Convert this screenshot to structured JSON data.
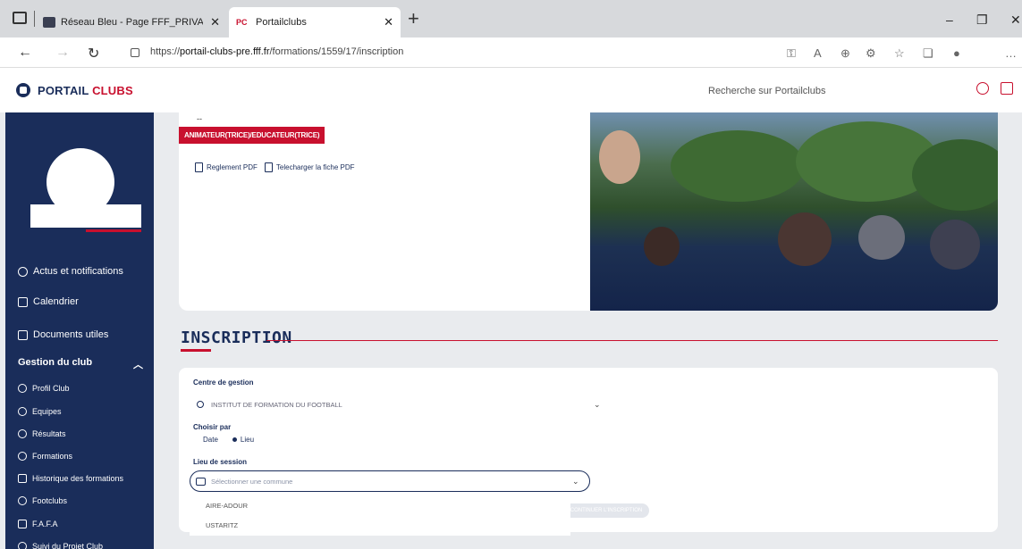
{
  "browser": {
    "tabs": [
      {
        "title": "Réseau Bleu - Page FFF_PRIVATE",
        "favicon": "database-icon"
      },
      {
        "title": "Portailclubs",
        "favicon_text": "PC"
      }
    ],
    "url_prefix": "https://",
    "url_host": "portail-clubs-pre.fff.fr",
    "url_path": "/formations/1559/17/inscription"
  },
  "header": {
    "logo_part1": "PORTAIL",
    "logo_part2": "CLUBS",
    "search_placeholder": "Recherche sur Portailclubs"
  },
  "sidebar": {
    "items": [
      {
        "label": "Actus et notifications",
        "icon": "bell-icon"
      },
      {
        "label": "Calendrier",
        "icon": "calendar-icon"
      },
      {
        "label": "Documents utiles",
        "icon": "document-icon"
      }
    ],
    "section_label": "Gestion du club",
    "sub_items": [
      {
        "label": "Profil Club",
        "icon": "shield-icon"
      },
      {
        "label": "Equipes",
        "icon": "team-icon"
      },
      {
        "label": "Résultats",
        "icon": "trophy-icon"
      },
      {
        "label": "Formations",
        "icon": "graduation-icon"
      },
      {
        "label": "Historique des formations",
        "icon": "history-icon"
      },
      {
        "label": "Footclubs",
        "icon": "gear-icon"
      },
      {
        "label": "F.A.F.A",
        "icon": "wallet-icon"
      },
      {
        "label": "Suivi du Projet Club",
        "icon": "target-icon"
      }
    ]
  },
  "formation": {
    "dash": "--",
    "role_badge": "ANIMATEUR(TRICE)/EDUCATEUR(TRICE)",
    "pdf_links": [
      "Reglement PDF",
      "Telecharger la fiche PDF"
    ]
  },
  "inscription": {
    "title": "INSCRIPTION",
    "centre_label": "Centre de gestion",
    "centre_value": "INSTITUT DE FORMATION DU FOOTBALL",
    "choice_label": "Choisir par",
    "choice_options": [
      "Date",
      "Lieu"
    ],
    "choice_selected": "Lieu",
    "lieu_label": "Lieu de session",
    "lieu_placeholder": "Sélectionner une commune",
    "dropdown_options": [
      "AIRE-ADOUR",
      "USTARITZ"
    ],
    "next_button": "CONTINUER L'INSCRIPTION"
  },
  "colors": {
    "navy": "#1a2d5a",
    "red": "#c8102e"
  }
}
